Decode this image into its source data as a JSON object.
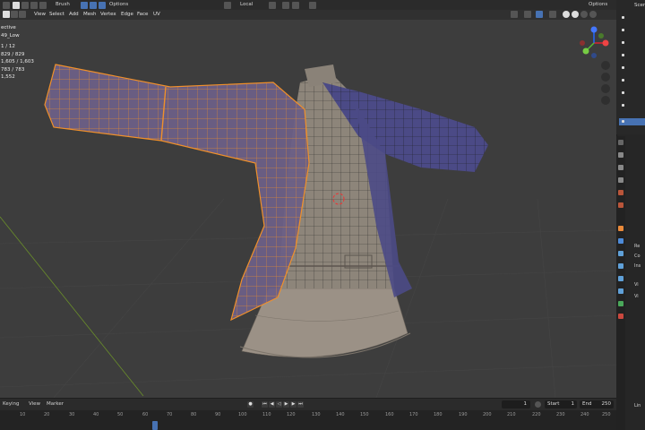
{
  "toolbar": {
    "brush_label": "Brush",
    "options_label": "Options",
    "transform_orientation": "Local",
    "right_options_label": "Options"
  },
  "menu": {
    "items": [
      "View",
      "Select",
      "Add",
      "Mesh",
      "Vertex",
      "Edge",
      "Face",
      "UV"
    ]
  },
  "stats": {
    "lines": [
      "ective",
      "49_Low",
      "",
      "1 / 12",
      "829 / 829",
      "1,605 / 1,603",
      "783 / 783",
      "1,552"
    ]
  },
  "outliner": {
    "header_text": "Scen"
  },
  "properties": {
    "labels": [
      "Re",
      "Co",
      "Ins",
      "Vi",
      "Vi"
    ]
  },
  "timeline": {
    "menu_items": [
      "Keying",
      "View",
      "Marker"
    ],
    "current_frame": "1",
    "start_label": "Start",
    "start_value": "1",
    "end_label": "End",
    "end_value": "250",
    "ticks": [
      "10",
      "20",
      "30",
      "40",
      "50",
      "60",
      "70",
      "80",
      "90",
      "100",
      "110",
      "120",
      "130",
      "140",
      "150",
      "160",
      "170",
      "180",
      "190",
      "200",
      "210",
      "220",
      "230",
      "240",
      "250"
    ],
    "bottom_right_label": "Lin"
  },
  "colors": {
    "selection_edge": "#f0902a",
    "mesh_wire": "#1a1a1a",
    "jacket_fill": "#4b4a86",
    "dress_fill": "#9b9186"
  }
}
